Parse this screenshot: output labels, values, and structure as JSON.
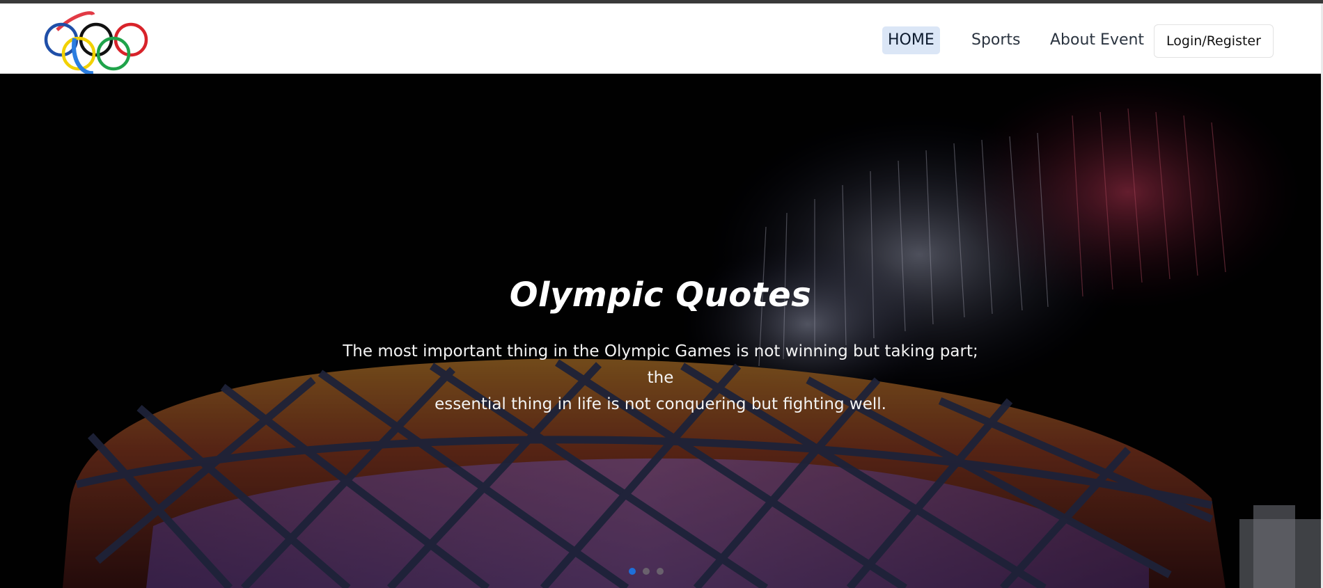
{
  "nav": {
    "logo_alt": "Olympic rings logo",
    "links": [
      {
        "label": "HOME",
        "active": true
      },
      {
        "label": "Sports",
        "active": false
      },
      {
        "label": "About Event",
        "active": false
      }
    ],
    "login_label": "Login/Register"
  },
  "hero": {
    "title": "Olympic Quotes",
    "quote_line1": "The most important thing in the Olympic Games is not winning but taking part; the",
    "quote_line2": "essential thing in life is not conquering but fighting well.",
    "active_slide": 1,
    "slide_count": 3
  },
  "colors": {
    "ring_blue": "#1f4fa8",
    "ring_yellow": "#f2d100",
    "ring_black": "#111111",
    "ring_green": "#1fa34a",
    "ring_red": "#d8232a",
    "nav_active_bg": "#dbe6f6",
    "indicator_active": "#1e6fd9"
  }
}
